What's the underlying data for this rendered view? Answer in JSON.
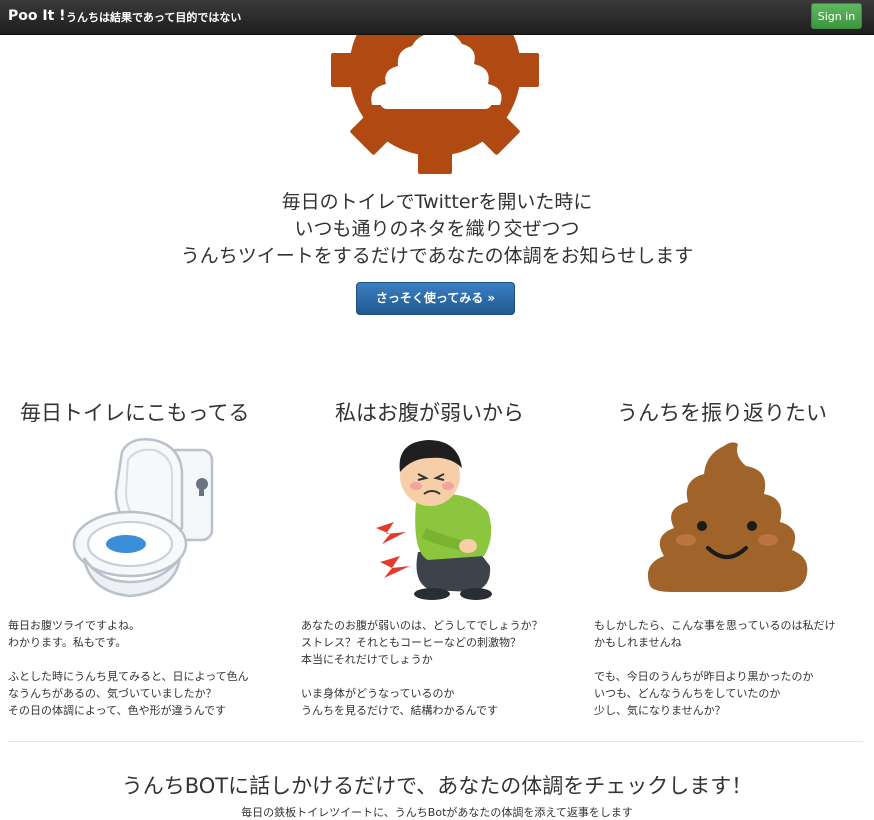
{
  "navbar": {
    "brand": "Poo It !",
    "tagline": "うんちは結果であって目的ではない",
    "signin_label": "Sign in"
  },
  "hero": {
    "lines": [
      "毎日のトイレでTwitterを開いた時に",
      "いつも通りのネタを織り交ぜつつ",
      "うんちツイートをするだけであなたの体調をお知らせします"
    ],
    "cta_label": "さっそく使ってみる »"
  },
  "features": [
    {
      "title": "毎日トイレにこもってる",
      "image": "toilet-illustration",
      "text": "毎日お腹ツライですよね。\nわかります。私もです。\n\nふとした時にうんち見てみると、日によって色ん\nなうんちがあるの、気づいていましたか？\nその日の体調によって、色や形が違うんです"
    },
    {
      "title": "私はお腹が弱いから",
      "image": "stomachache-man-illustration",
      "text": "あなたのお腹が弱いのは、どうしてでしょうか？\nストレス？それともコーヒーなどの刺激物？\n本当にそれだけでしょうか\n\nいま身体がどうなっているのか\nうんちを見るだけで、結構わかるんです"
    },
    {
      "title": "うんちを振り返りたい",
      "image": "smiling-poop-illustration",
      "text": "もしかしたら、こんな事を思っているのは私だけ\nかもしれませんね\n\nでも、今日のうんちが昨日より黒かったのか\nいつも、どんなうんちをしていたのか\n少し、気になりませんか？"
    }
  ],
  "bottom": {
    "title": "うんちBOTに話しかけるだけで、あなたの体調をチェックします！",
    "subtitle": "毎日の鉄板トイレツイートに、うんちBotがあなたの体調を添えて返事をします"
  },
  "colors": {
    "navbar": "#1e1e1e",
    "signin": "#4cae4c",
    "cta": "#2a6aa8",
    "logo": "#b04a12",
    "poop": "#a0642a"
  }
}
